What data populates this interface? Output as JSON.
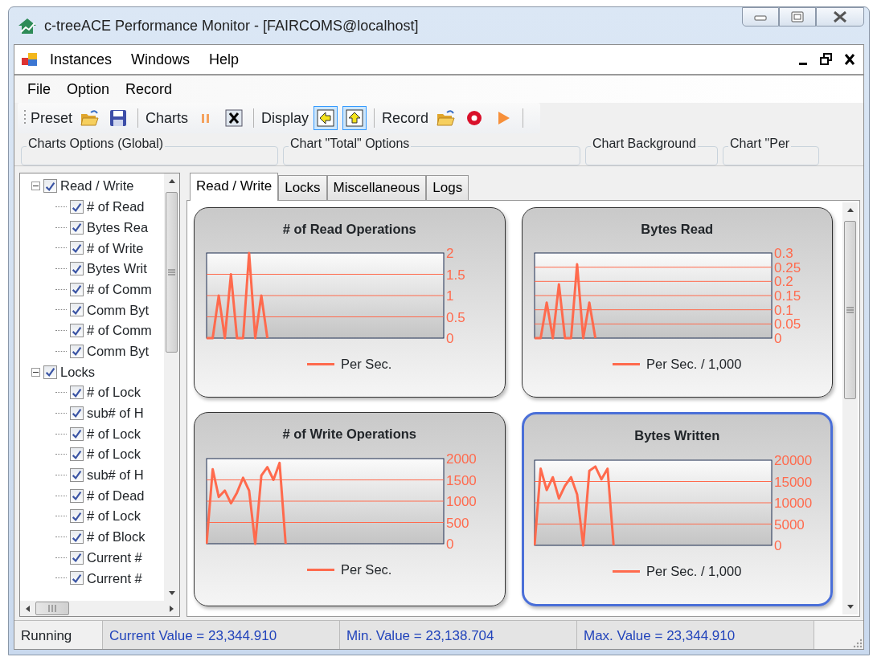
{
  "window": {
    "title": "c-treeACE Performance Monitor - [FAIRCOMS@localhost]"
  },
  "main_menu": [
    "Instances",
    "Windows",
    "Help"
  ],
  "child_menu": [
    "File",
    "Option",
    "Record"
  ],
  "toolbar": [
    {
      "label": "Preset",
      "buttons": [
        {
          "kind": "open",
          "pressed": false
        },
        {
          "kind": "save",
          "pressed": false
        }
      ]
    },
    {
      "label": "Charts",
      "buttons": [
        {
          "kind": "pause",
          "pressed": false
        },
        {
          "kind": "delete",
          "pressed": false
        }
      ]
    },
    {
      "label": "Display",
      "buttons": [
        {
          "kind": "arrange-left",
          "pressed": true
        },
        {
          "kind": "arrange-up",
          "pressed": true
        }
      ]
    },
    {
      "label": "Record",
      "buttons": [
        {
          "kind": "open",
          "pressed": false
        },
        {
          "kind": "record",
          "pressed": false
        },
        {
          "kind": "play",
          "pressed": false
        }
      ]
    }
  ],
  "option_groups": [
    "Charts Options (Global)",
    "Chart \"Total\" Options",
    "Chart Background",
    "Chart \"Per"
  ],
  "tree": [
    {
      "label": "Read / Write",
      "checked": true,
      "expanded": true,
      "children": [
        {
          "label": "# of Read",
          "checked": true
        },
        {
          "label": "Bytes Rea",
          "checked": true
        },
        {
          "label": "# of Write",
          "checked": true
        },
        {
          "label": "Bytes Writ",
          "checked": true
        },
        {
          "label": "# of Comm",
          "checked": true
        },
        {
          "label": "Comm Byt",
          "checked": true
        },
        {
          "label": "# of Comm",
          "checked": true
        },
        {
          "label": "Comm Byt",
          "checked": true
        }
      ]
    },
    {
      "label": "Locks",
      "checked": true,
      "expanded": true,
      "children": [
        {
          "label": "# of Lock",
          "checked": true
        },
        {
          "label": "sub# of H",
          "checked": true
        },
        {
          "label": "# of Lock",
          "checked": true
        },
        {
          "label": "# of Lock",
          "checked": true
        },
        {
          "label": "sub# of H",
          "checked": true
        },
        {
          "label": "# of Dead",
          "checked": true
        },
        {
          "label": "# of Lock",
          "checked": true
        },
        {
          "label": "# of Block",
          "checked": true
        },
        {
          "label": "Current #",
          "checked": true
        },
        {
          "label": "Current #",
          "checked": true
        }
      ]
    }
  ],
  "tabs": [
    {
      "label": "Read / Write",
      "selected": true
    },
    {
      "label": "Locks",
      "selected": false
    },
    {
      "label": "Miscellaneous",
      "selected": false
    },
    {
      "label": "Logs",
      "selected": false
    }
  ],
  "charts": [
    {
      "selected": false,
      "chart_data": {
        "type": "line",
        "grid": true,
        "title": "# of Read Operations",
        "ylim": [
          0,
          2
        ],
        "yticks": [
          0,
          0.5,
          1,
          1.5,
          2
        ],
        "series": [
          {
            "name": "Per Sec.",
            "color": "#ff6a4d",
            "values": [
              0,
              0,
              1,
              0,
              1.5,
              0,
              0,
              2,
              0,
              1,
              0,
              null,
              null,
              null,
              null,
              null,
              null,
              null,
              null,
              null,
              null,
              null,
              null,
              null,
              null,
              null,
              null,
              null,
              null,
              null,
              null,
              null,
              null,
              null,
              null,
              null,
              null,
              null,
              null,
              null
            ]
          }
        ]
      }
    },
    {
      "selected": false,
      "chart_data": {
        "type": "line",
        "grid": true,
        "title": "Bytes Read",
        "ylim": [
          0,
          0.3
        ],
        "yticks": [
          0,
          0.05,
          0.1,
          0.15,
          0.2,
          0.25,
          0.3
        ],
        "series": [
          {
            "name": "Per Sec. / 1,000",
            "color": "#ff6a4d",
            "values": [
              0,
              0,
              0.125,
              0,
              0.19,
              0,
              0,
              0.26,
              0,
              0.125,
              0,
              null,
              null,
              null,
              null,
              null,
              null,
              null,
              null,
              null,
              null,
              null,
              null,
              null,
              null,
              null,
              null,
              null,
              null,
              null,
              null,
              null,
              null,
              null,
              null,
              null,
              null,
              null,
              null,
              null
            ]
          }
        ]
      }
    },
    {
      "selected": false,
      "chart_data": {
        "type": "line",
        "grid": true,
        "title": "# of Write Operations",
        "ylim": [
          0,
          2000
        ],
        "yticks": [
          0,
          500,
          1000,
          1500,
          2000
        ],
        "series": [
          {
            "name": "Per Sec.",
            "color": "#ff6a4d",
            "values": [
              0,
              1750,
              1100,
              1250,
              950,
              1200,
              1550,
              1250,
              0,
              1600,
              1800,
              1500,
              1900,
              0,
              null,
              null,
              null,
              null,
              null,
              null,
              null,
              null,
              null,
              null,
              null,
              null,
              null,
              null,
              null,
              null,
              null,
              null,
              null,
              null,
              null,
              null,
              null,
              null,
              null,
              null
            ]
          }
        ]
      }
    },
    {
      "selected": true,
      "chart_data": {
        "type": "line",
        "grid": true,
        "title": "Bytes Written",
        "ylim": [
          0,
          20000
        ],
        "yticks": [
          0,
          5000,
          10000,
          15000,
          20000
        ],
        "series": [
          {
            "name": "Per Sec. / 1,000",
            "color": "#ff6a4d",
            "values": [
              0,
              18000,
              13000,
              16000,
              11000,
              14000,
              16000,
              12000,
              0,
              17500,
              18500,
              15500,
              18000,
              0,
              null,
              null,
              null,
              null,
              null,
              null,
              null,
              null,
              null,
              null,
              null,
              null,
              null,
              null,
              null,
              null,
              null,
              null,
              null,
              null,
              null,
              null,
              null,
              null,
              null,
              null
            ]
          }
        ]
      }
    }
  ],
  "status_bar": [
    "Running",
    "Current Value = 23,344.910",
    "Min. Value = 23,138.704",
    "Max. Value = 23,344.910"
  ]
}
